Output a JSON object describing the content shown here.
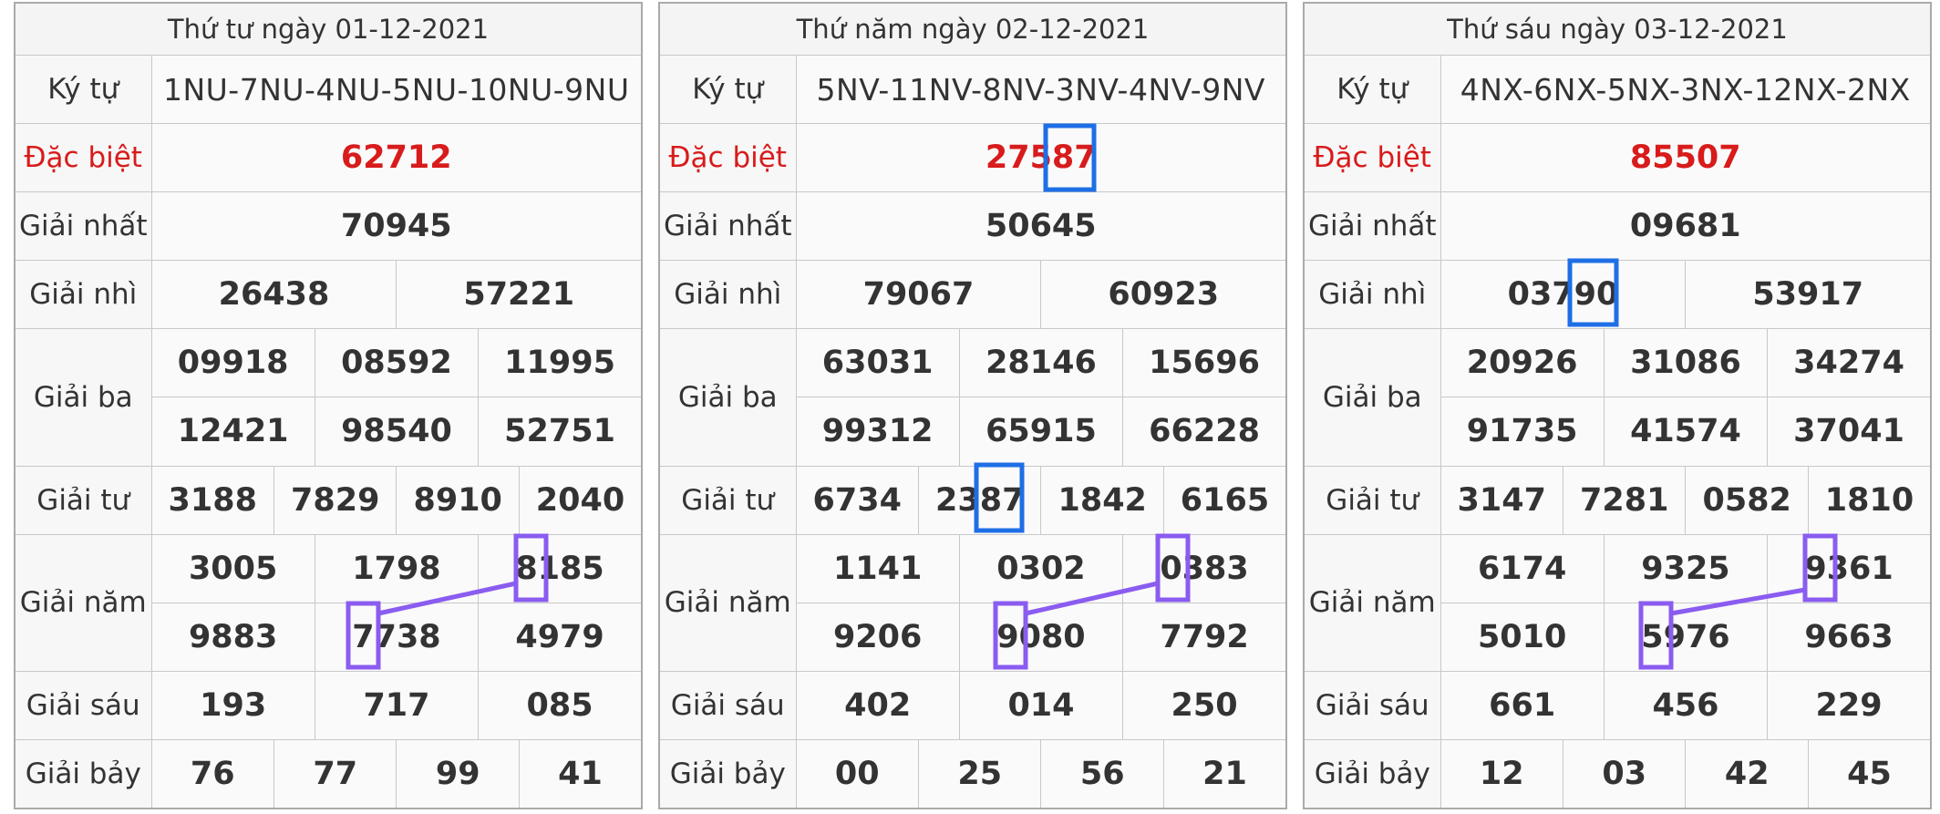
{
  "panels": [
    {
      "title": "Thứ tư ngày 01-12-2021",
      "ky_tu": "1NU-7NU-4NU-5NU-10NU-9NU",
      "dac_biet": "62712",
      "giai_nhat": "70945",
      "giai_nhi": [
        "26438",
        "57221"
      ],
      "giai_ba": [
        "09918",
        "08592",
        "11995",
        "12421",
        "98540",
        "52751"
      ],
      "giai_tu": [
        "3188",
        "7829",
        "8910",
        "2040"
      ],
      "giai_nam": [
        "3005",
        "1798",
        "8185",
        "9883",
        "7738",
        "4979"
      ],
      "giai_sau": [
        "193",
        "717",
        "085"
      ],
      "giai_bay": [
        "76",
        "77",
        "99",
        "41"
      ]
    },
    {
      "title": "Thứ năm ngày 02-12-2021",
      "ky_tu": "5NV-11NV-8NV-3NV-4NV-9NV",
      "dac_biet": "27587",
      "giai_nhat": "50645",
      "giai_nhi": [
        "79067",
        "60923"
      ],
      "giai_ba": [
        "63031",
        "28146",
        "15696",
        "99312",
        "65915",
        "66228"
      ],
      "giai_tu": [
        "6734",
        "2387",
        "1842",
        "6165"
      ],
      "giai_nam": [
        "1141",
        "0302",
        "0383",
        "9206",
        "9080",
        "7792"
      ],
      "giai_sau": [
        "402",
        "014",
        "250"
      ],
      "giai_bay": [
        "00",
        "25",
        "56",
        "21"
      ]
    },
    {
      "title": "Thứ sáu ngày 03-12-2021",
      "ky_tu": "4NX-6NX-5NX-3NX-12NX-2NX",
      "dac_biet": "85507",
      "giai_nhat": "09681",
      "giai_nhi": [
        "03790",
        "53917"
      ],
      "giai_ba": [
        "20926",
        "31086",
        "34274",
        "91735",
        "41574",
        "37041"
      ],
      "giai_tu": [
        "3147",
        "7281",
        "0582",
        "1810"
      ],
      "giai_nam": [
        "6174",
        "9325",
        "9361",
        "5010",
        "5976",
        "9663"
      ],
      "giai_sau": [
        "661",
        "456",
        "229"
      ],
      "giai_bay": [
        "12",
        "03",
        "42",
        "45"
      ]
    }
  ],
  "labels": {
    "ky_tu": "Ký tự",
    "dac_biet": "Đặc biệt",
    "giai_nhat": "Giải nhất",
    "giai_nhi": "Giải nhì",
    "giai_ba": "Giải ba",
    "giai_tu": "Giải tư",
    "giai_nam": "Giải năm",
    "giai_sau": "Giải sáu",
    "giai_bay": "Giải bảy"
  },
  "colors": {
    "special": "#d81b1b",
    "blue_highlight": "#1e6fe6",
    "purple_highlight": "#8a5cf0"
  }
}
